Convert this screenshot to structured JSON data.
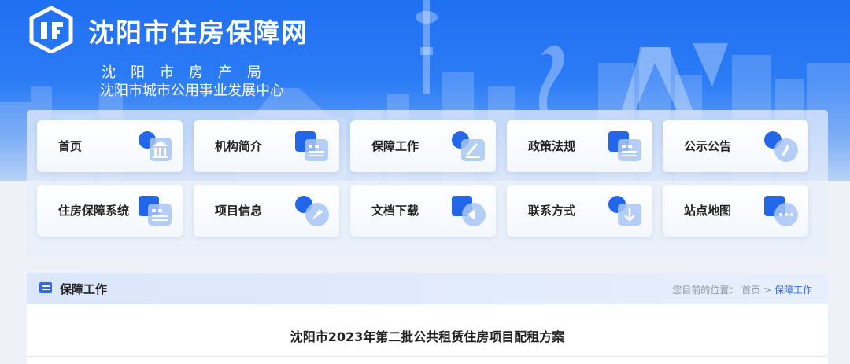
{
  "header": {
    "site_title": "沈阳市住房保障网",
    "subtitle_1": "沈阳市房产局",
    "subtitle_2": "沈阳市城市公用事业发展中心"
  },
  "nav": {
    "items": [
      {
        "label": "首页",
        "icon": "home-icon"
      },
      {
        "label": "机构简介",
        "icon": "document-icon"
      },
      {
        "label": "保障工作",
        "icon": "edit-icon"
      },
      {
        "label": "政策法规",
        "icon": "document-icon"
      },
      {
        "label": "公示公告",
        "icon": "announcement-icon"
      },
      {
        "label": "住房保障系统",
        "icon": "document-icon"
      },
      {
        "label": "项目信息",
        "icon": "compass-icon"
      },
      {
        "label": "文档下载",
        "icon": "download-icon"
      },
      {
        "label": "联系方式",
        "icon": "arrow-down-icon"
      },
      {
        "label": "站点地图",
        "icon": "more-icon"
      }
    ]
  },
  "section": {
    "title": "保障工作",
    "breadcrumb_prefix": "您目前的位置：",
    "breadcrumb_home": "首页",
    "breadcrumb_sep": " > ",
    "breadcrumb_current": "保障工作"
  },
  "article": {
    "title": "沈阳市2023年第二批公共租赁住房项目配租方案"
  },
  "colors": {
    "brand_blue": "#1f6ff2",
    "accent": "#2f6be6"
  }
}
